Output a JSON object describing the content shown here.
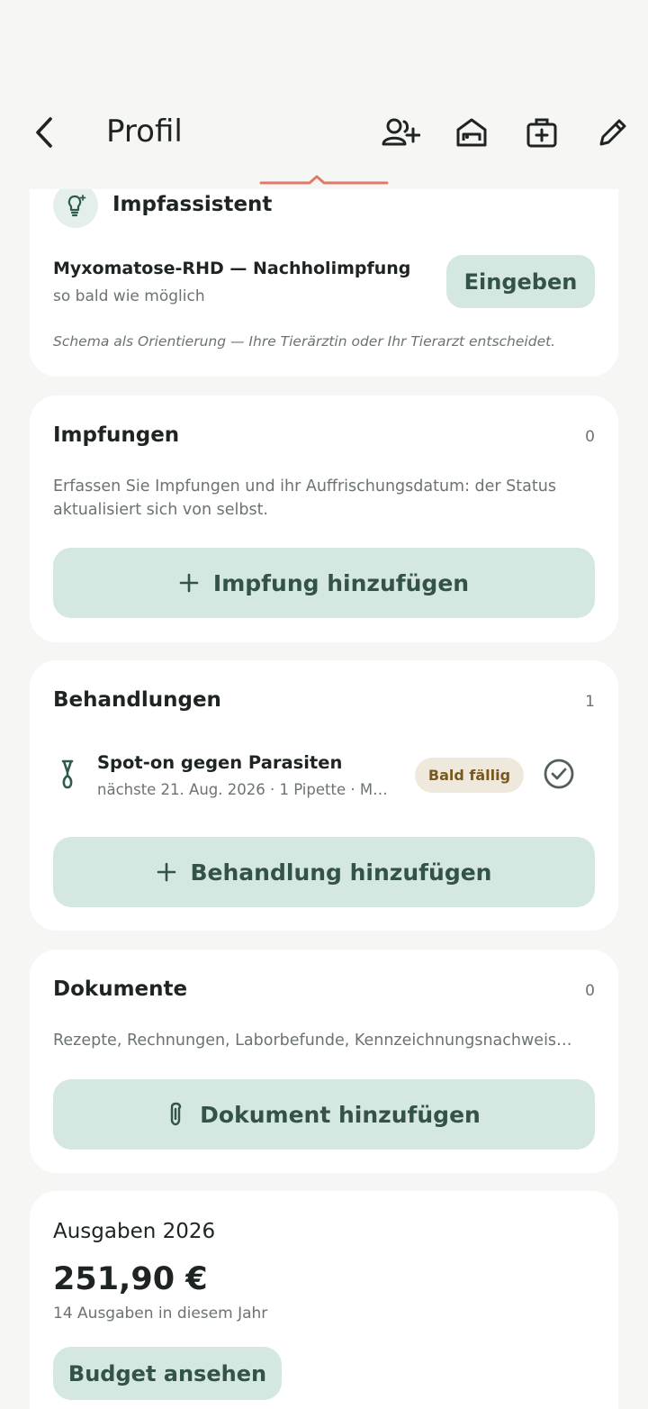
{
  "header": {
    "title": "Profil",
    "icons": [
      "back-chevron-icon",
      "add-person-icon",
      "home-icon",
      "medical-kit-icon",
      "edit-pencil-icon"
    ]
  },
  "vaccine_assistant": {
    "title": "Impfassistent",
    "item_title": "Myxomatose-RHD — Nachholimpfung",
    "item_subtitle": "so bald wie möglich",
    "enter_label": "Eingeben",
    "note": "Schema als Orientierung — Ihre Tierärztin oder Ihr Tierarzt entscheidet."
  },
  "vaccinations": {
    "title": "Impfungen",
    "count": "0",
    "description": "Erfassen Sie Impfungen und ihr Auffrischungsdatum: der Status aktualisiert sich von selbst.",
    "add_label": "Impfung hinzufügen"
  },
  "treatments": {
    "title": "Behandlungen",
    "count": "1",
    "items": [
      {
        "title": "Spot-on gegen Parasiten",
        "subtitle": "nächste 21. Aug. 2026 · 1 Pipette · M…",
        "badge": "Bald fällig"
      }
    ],
    "add_label": "Behandlung hinzufügen"
  },
  "documents": {
    "title": "Dokumente",
    "count": "0",
    "description": "Rezepte, Rechnungen, Laborbefunde, Kennzeichnungsnachweis…",
    "add_label": "Dokument hinzufügen"
  },
  "expenses": {
    "title": "Ausgaben 2026",
    "amount": "251,90 €",
    "subtitle": "14 Ausgaben in diesem Jahr",
    "budget_label": "Budget ansehen"
  },
  "colors": {
    "background": "#f6f6f4",
    "card": "#ffffff",
    "button": "#d4e7e0",
    "button_text": "#33524a",
    "accent_line": "#e07a66",
    "badge_bg": "#efe9dd",
    "badge_text": "#7a5a1c"
  }
}
